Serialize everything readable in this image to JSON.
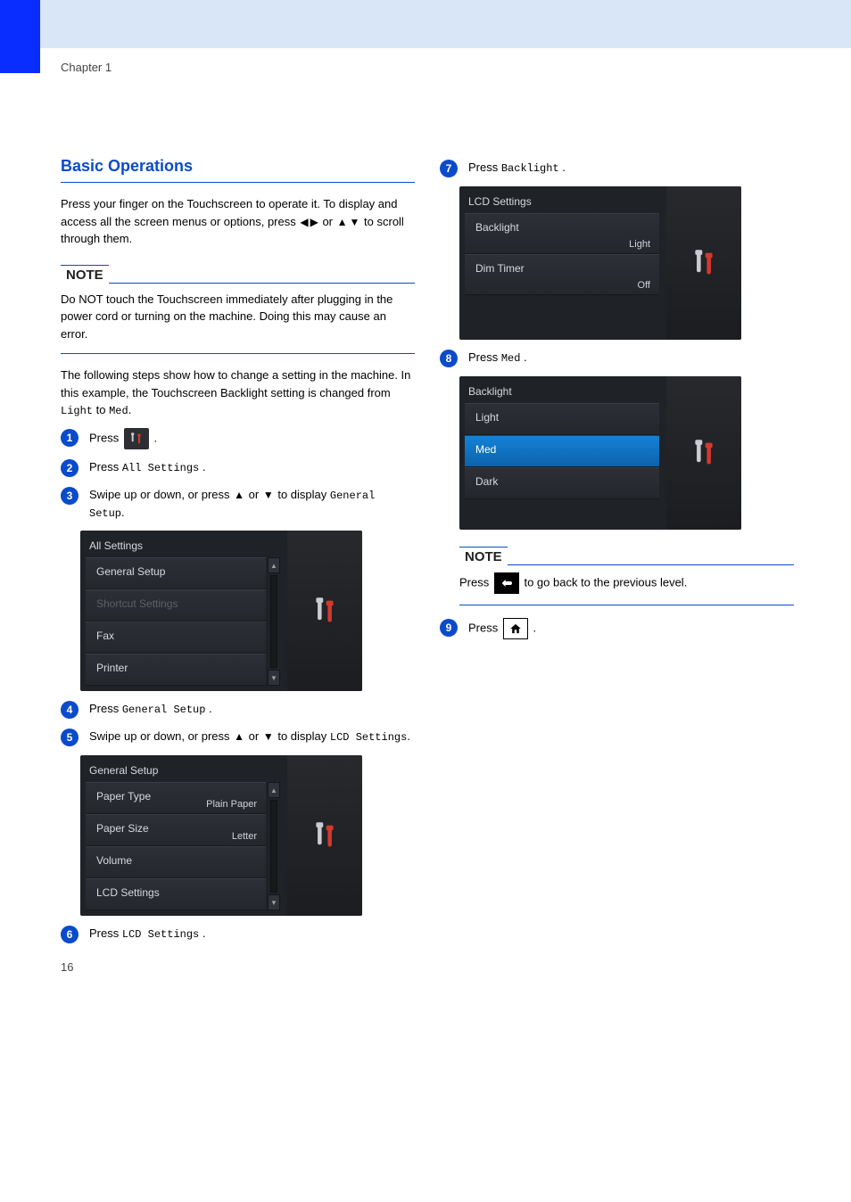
{
  "page_number": "16",
  "chapter_label": "Chapter 1",
  "left": {
    "heading1": "Basic Operations",
    "para1_prefix": "Press your finger on the Touchscreen to operate it. To display and access all the screen menus or options, press ",
    "para1_mid": " or ",
    "para1_suffix": " to scroll through them.",
    "note_title": "NOTE",
    "note_text": "Do NOT touch the Touchscreen immediately after plugging in the power cord or turning on the machine. Doing this may cause an error.",
    "para2": "The following steps show how to change a setting in the machine. In this example, the Touchscreen Backlight setting is changed from ",
    "para2_from": "Light",
    "para2_to": "Med",
    "step1_prefix": "Press ",
    "step1_icon": "settings-icon",
    "step1_suffix": ".",
    "step2_prefix": "Press ",
    "step2_label": "All Settings",
    "step2_suffix": ".",
    "step3_prefix": "Swipe up or down, or press ",
    "step3_mid": " or ",
    "step3_end": " to display ",
    "step3_target": "General Setup",
    "screen_all_settings": {
      "title": "All Settings",
      "items": [
        "General Setup",
        "Shortcut Settings",
        "Fax",
        "Printer"
      ]
    },
    "step4_prefix": "Press ",
    "step4_label": "General Setup",
    "step4_suffix": ".",
    "step5_prefix": "Swipe up or down, or press ",
    "step5_mid": " or ",
    "step5_end": " to display ",
    "step5_target": "LCD Settings",
    "screen_general_setup": {
      "title": "General Setup",
      "items": [
        {
          "label": "Paper Type",
          "value": "Plain Paper"
        },
        {
          "label": "Paper Size",
          "value": "Letter"
        },
        {
          "label": "Volume",
          "value": ""
        },
        {
          "label": "LCD Settings",
          "value": ""
        }
      ]
    },
    "step6_prefix": "Press ",
    "step6_label": "LCD Settings",
    "step6_suffix": "."
  },
  "right": {
    "step7_prefix": "Press ",
    "step7_label": "Backlight",
    "step7_suffix": ".",
    "screen_lcd_settings": {
      "title": "LCD Settings",
      "items": [
        {
          "label": "Backlight",
          "value": "Light"
        },
        {
          "label": "Dim Timer",
          "value": "Off"
        }
      ]
    },
    "step8_prefix": "Press ",
    "step8_label": "Med",
    "step8_suffix": ".",
    "screen_backlight": {
      "title": "Backlight",
      "options": [
        "Light",
        "Med",
        "Dark"
      ],
      "selected": "Med"
    },
    "note_title": "NOTE",
    "note_text_prefix": "Press ",
    "note_text_suffix": " to go back to the previous level.",
    "step9_prefix": "Press ",
    "step9_suffix": "."
  },
  "icons": {
    "arrow_left": "◀",
    "arrow_right": "▶",
    "arrow_up": "▲",
    "arrow_down": "▼"
  }
}
